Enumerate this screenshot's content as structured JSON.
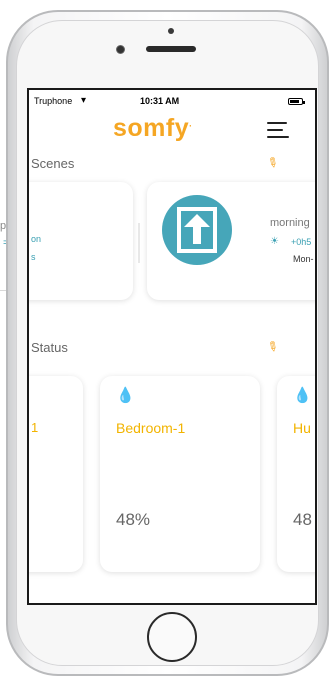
{
  "backdrop": {
    "left_fragment_1": "p",
    "left_fragment_2": "="
  },
  "status_bar": {
    "carrier": "Truphone",
    "time": "10:31 AM"
  },
  "header": {
    "logo": "somfy"
  },
  "scenes": {
    "title": "Scenes",
    "left_card": {
      "line1": "on",
      "line2": "s"
    },
    "right_card": {
      "name": "morning",
      "offset": "+0h5",
      "days": "Mon-"
    }
  },
  "status": {
    "title": "Status",
    "cards": [
      {
        "name": "1",
        "value": ""
      },
      {
        "name": "Bedroom-1",
        "value": "48%"
      },
      {
        "name": "Hu",
        "value": "48"
      }
    ]
  },
  "icons": {
    "wifi": "wifi-icon",
    "battery": "battery-icon",
    "menu": "hamburger-menu-icon",
    "pin": "pin-icon",
    "drop": "water-drop-icon",
    "scene": "shutter-up-icon",
    "sunrise": "sunrise-icon"
  },
  "colors": {
    "brand": "#f5a623",
    "teal": "#46a6b9",
    "label_yellow": "#f2b400"
  }
}
